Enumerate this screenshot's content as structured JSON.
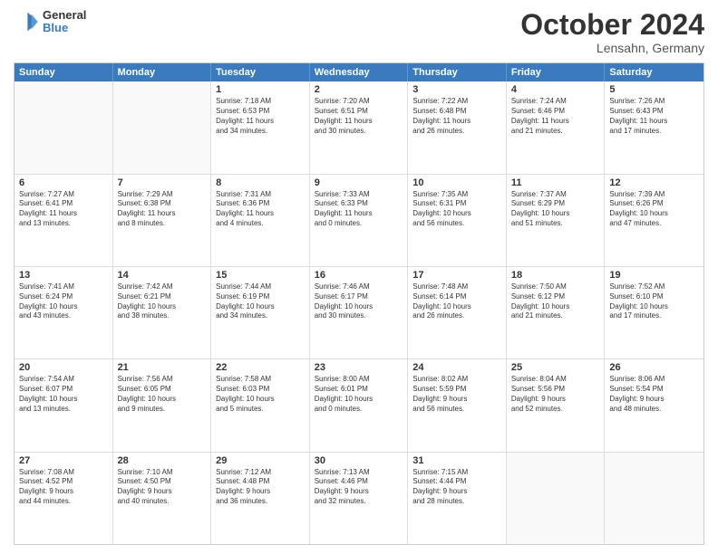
{
  "logo": {
    "general": "General",
    "blue": "Blue"
  },
  "title": {
    "month": "October 2024",
    "location": "Lensahn, Germany"
  },
  "header_days": [
    "Sunday",
    "Monday",
    "Tuesday",
    "Wednesday",
    "Thursday",
    "Friday",
    "Saturday"
  ],
  "rows": [
    [
      {
        "day": "",
        "text": "",
        "empty": true
      },
      {
        "day": "",
        "text": "",
        "empty": true
      },
      {
        "day": "1",
        "text": "Sunrise: 7:18 AM\nSunset: 6:53 PM\nDaylight: 11 hours\nand 34 minutes."
      },
      {
        "day": "2",
        "text": "Sunrise: 7:20 AM\nSunset: 6:51 PM\nDaylight: 11 hours\nand 30 minutes."
      },
      {
        "day": "3",
        "text": "Sunrise: 7:22 AM\nSunset: 6:48 PM\nDaylight: 11 hours\nand 26 minutes."
      },
      {
        "day": "4",
        "text": "Sunrise: 7:24 AM\nSunset: 6:46 PM\nDaylight: 11 hours\nand 21 minutes."
      },
      {
        "day": "5",
        "text": "Sunrise: 7:26 AM\nSunset: 6:43 PM\nDaylight: 11 hours\nand 17 minutes."
      }
    ],
    [
      {
        "day": "6",
        "text": "Sunrise: 7:27 AM\nSunset: 6:41 PM\nDaylight: 11 hours\nand 13 minutes."
      },
      {
        "day": "7",
        "text": "Sunrise: 7:29 AM\nSunset: 6:38 PM\nDaylight: 11 hours\nand 8 minutes."
      },
      {
        "day": "8",
        "text": "Sunrise: 7:31 AM\nSunset: 6:36 PM\nDaylight: 11 hours\nand 4 minutes."
      },
      {
        "day": "9",
        "text": "Sunrise: 7:33 AM\nSunset: 6:33 PM\nDaylight: 11 hours\nand 0 minutes."
      },
      {
        "day": "10",
        "text": "Sunrise: 7:35 AM\nSunset: 6:31 PM\nDaylight: 10 hours\nand 56 minutes."
      },
      {
        "day": "11",
        "text": "Sunrise: 7:37 AM\nSunset: 6:29 PM\nDaylight: 10 hours\nand 51 minutes."
      },
      {
        "day": "12",
        "text": "Sunrise: 7:39 AM\nSunset: 6:26 PM\nDaylight: 10 hours\nand 47 minutes."
      }
    ],
    [
      {
        "day": "13",
        "text": "Sunrise: 7:41 AM\nSunset: 6:24 PM\nDaylight: 10 hours\nand 43 minutes."
      },
      {
        "day": "14",
        "text": "Sunrise: 7:42 AM\nSunset: 6:21 PM\nDaylight: 10 hours\nand 38 minutes."
      },
      {
        "day": "15",
        "text": "Sunrise: 7:44 AM\nSunset: 6:19 PM\nDaylight: 10 hours\nand 34 minutes."
      },
      {
        "day": "16",
        "text": "Sunrise: 7:46 AM\nSunset: 6:17 PM\nDaylight: 10 hours\nand 30 minutes."
      },
      {
        "day": "17",
        "text": "Sunrise: 7:48 AM\nSunset: 6:14 PM\nDaylight: 10 hours\nand 26 minutes."
      },
      {
        "day": "18",
        "text": "Sunrise: 7:50 AM\nSunset: 6:12 PM\nDaylight: 10 hours\nand 21 minutes."
      },
      {
        "day": "19",
        "text": "Sunrise: 7:52 AM\nSunset: 6:10 PM\nDaylight: 10 hours\nand 17 minutes."
      }
    ],
    [
      {
        "day": "20",
        "text": "Sunrise: 7:54 AM\nSunset: 6:07 PM\nDaylight: 10 hours\nand 13 minutes."
      },
      {
        "day": "21",
        "text": "Sunrise: 7:56 AM\nSunset: 6:05 PM\nDaylight: 10 hours\nand 9 minutes."
      },
      {
        "day": "22",
        "text": "Sunrise: 7:58 AM\nSunset: 6:03 PM\nDaylight: 10 hours\nand 5 minutes."
      },
      {
        "day": "23",
        "text": "Sunrise: 8:00 AM\nSunset: 6:01 PM\nDaylight: 10 hours\nand 0 minutes."
      },
      {
        "day": "24",
        "text": "Sunrise: 8:02 AM\nSunset: 5:59 PM\nDaylight: 9 hours\nand 56 minutes."
      },
      {
        "day": "25",
        "text": "Sunrise: 8:04 AM\nSunset: 5:56 PM\nDaylight: 9 hours\nand 52 minutes."
      },
      {
        "day": "26",
        "text": "Sunrise: 8:06 AM\nSunset: 5:54 PM\nDaylight: 9 hours\nand 48 minutes."
      }
    ],
    [
      {
        "day": "27",
        "text": "Sunrise: 7:08 AM\nSunset: 4:52 PM\nDaylight: 9 hours\nand 44 minutes."
      },
      {
        "day": "28",
        "text": "Sunrise: 7:10 AM\nSunset: 4:50 PM\nDaylight: 9 hours\nand 40 minutes."
      },
      {
        "day": "29",
        "text": "Sunrise: 7:12 AM\nSunset: 4:48 PM\nDaylight: 9 hours\nand 36 minutes."
      },
      {
        "day": "30",
        "text": "Sunrise: 7:13 AM\nSunset: 4:46 PM\nDaylight: 9 hours\nand 32 minutes."
      },
      {
        "day": "31",
        "text": "Sunrise: 7:15 AM\nSunset: 4:44 PM\nDaylight: 9 hours\nand 28 minutes."
      },
      {
        "day": "",
        "text": "",
        "empty": true
      },
      {
        "day": "",
        "text": "",
        "empty": true
      }
    ]
  ]
}
